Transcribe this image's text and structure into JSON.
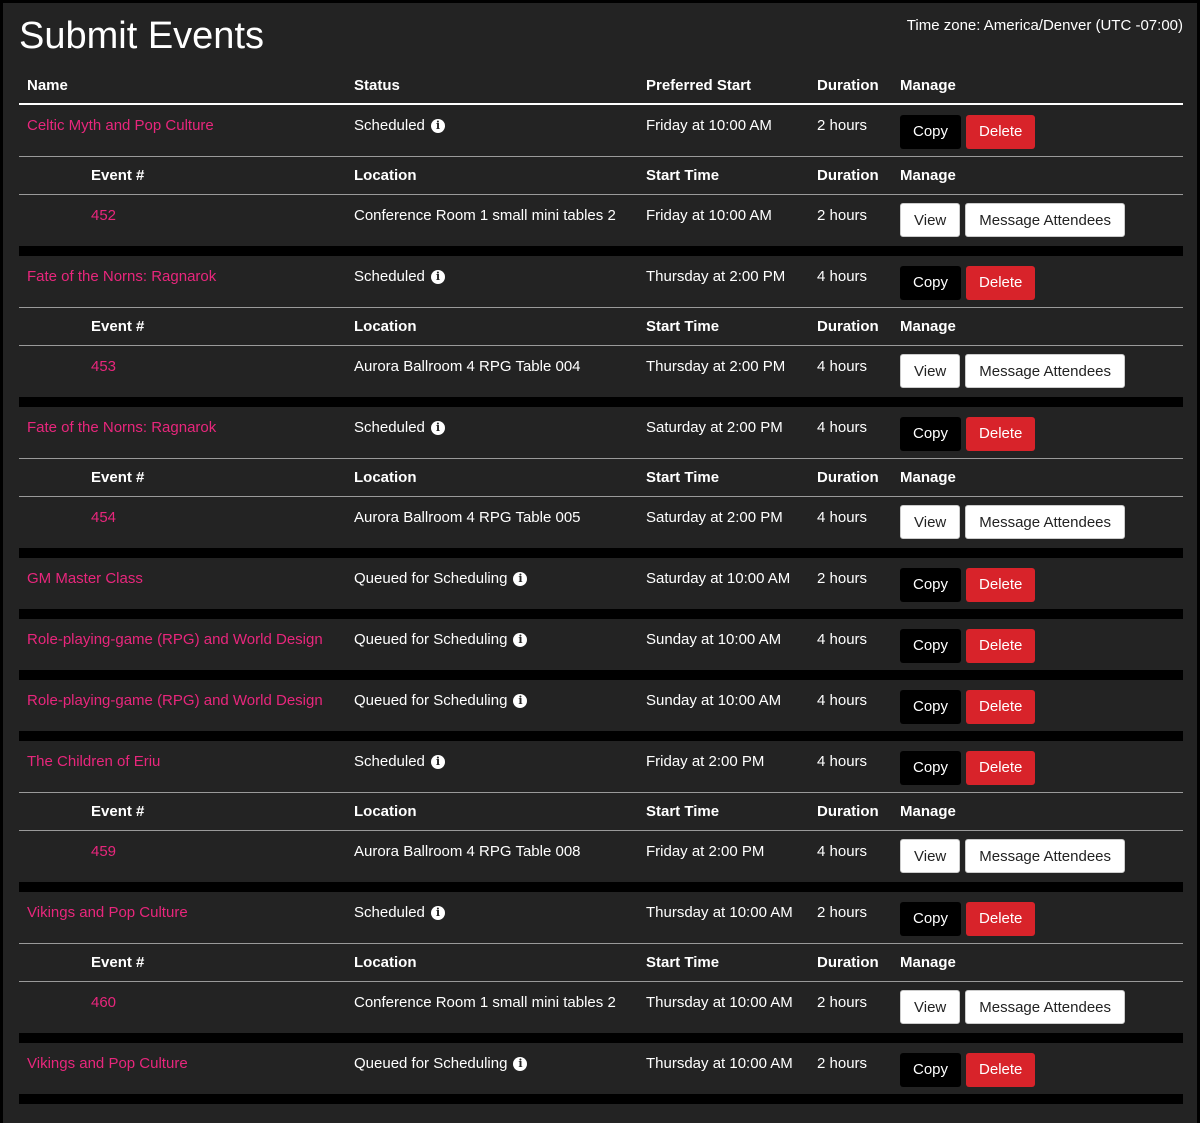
{
  "page": {
    "title": "Submit Events",
    "timezone": "Time zone: America/Denver (UTC -07:00)"
  },
  "headers": {
    "name": "Name",
    "status": "Status",
    "preferred_start": "Preferred Start",
    "duration": "Duration",
    "manage": "Manage"
  },
  "sub_headers": {
    "event_num": "Event #",
    "location": "Location",
    "start_time": "Start Time",
    "duration": "Duration",
    "manage": "Manage"
  },
  "buttons": {
    "copy": "Copy",
    "delete": "Delete",
    "view": "View",
    "message": "Message Attendees"
  },
  "info_icon": "info-circle-icon",
  "colors": {
    "link": "#e8267c",
    "delete": "#d8232a",
    "background": "#232323"
  },
  "events": [
    {
      "name": "Celtic Myth and Pop Culture",
      "status": "Scheduled",
      "start": "Friday at 10:00 AM",
      "duration": "2 hours",
      "sessions": [
        {
          "num": "452",
          "location": "Conference Room 1 small mini tables 2",
          "start": "Friday at 10:00 AM",
          "duration": "2 hours"
        }
      ]
    },
    {
      "name": "Fate of the Norns: Ragnarok",
      "status": "Scheduled",
      "start": "Thursday at 2:00 PM",
      "duration": "4 hours",
      "sessions": [
        {
          "num": "453",
          "location": "Aurora Ballroom 4 RPG Table 004",
          "start": "Thursday at 2:00 PM",
          "duration": "4 hours"
        }
      ]
    },
    {
      "name": "Fate of the Norns: Ragnarok",
      "status": "Scheduled",
      "start": "Saturday at 2:00 PM",
      "duration": "4 hours",
      "sessions": [
        {
          "num": "454",
          "location": "Aurora Ballroom 4 RPG Table 005",
          "start": "Saturday at 2:00 PM",
          "duration": "4 hours"
        }
      ]
    },
    {
      "name": "GM Master Class",
      "status": "Queued for Scheduling",
      "start": "Saturday at 10:00 AM",
      "duration": "2 hours",
      "sessions": []
    },
    {
      "name": "Role-playing-game (RPG) and World Design",
      "status": "Queued for Scheduling",
      "start": "Sunday at 10:00 AM",
      "duration": "4 hours",
      "sessions": []
    },
    {
      "name": "Role-playing-game (RPG) and World Design",
      "status": "Queued for Scheduling",
      "start": "Sunday at 10:00 AM",
      "duration": "4 hours",
      "sessions": []
    },
    {
      "name": "The Children of Eriu",
      "status": "Scheduled",
      "start": "Friday at 2:00 PM",
      "duration": "4 hours",
      "sessions": [
        {
          "num": "459",
          "location": "Aurora Ballroom 4 RPG Table 008",
          "start": "Friday at 2:00 PM",
          "duration": "4 hours"
        }
      ]
    },
    {
      "name": "Vikings and Pop Culture",
      "status": "Scheduled",
      "start": "Thursday at 10:00 AM",
      "duration": "2 hours",
      "sessions": [
        {
          "num": "460",
          "location": "Conference Room 1 small mini tables 2",
          "start": "Thursday at 10:00 AM",
          "duration": "2 hours"
        }
      ]
    },
    {
      "name": "Vikings and Pop Culture",
      "status": "Queued for Scheduling",
      "start": "Thursday at 10:00 AM",
      "duration": "2 hours",
      "sessions": []
    }
  ]
}
